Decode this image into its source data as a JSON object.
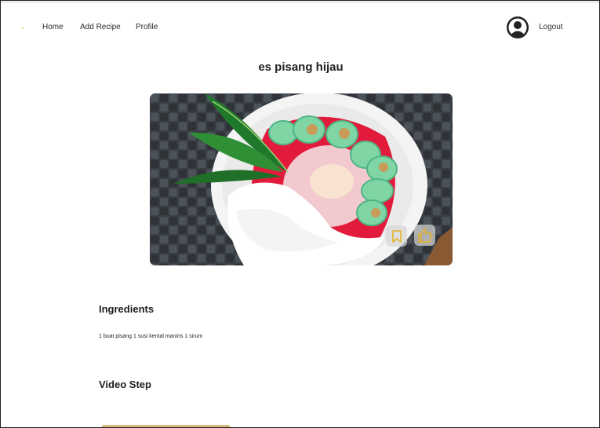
{
  "nav": {
    "home_label": "Home",
    "add_recipe_label": "Add Recipe",
    "profile_label": "Profile",
    "logout_label": "Logout"
  },
  "recipe": {
    "title": "es pisang hijau",
    "ingredients_heading": "Ingredients",
    "ingredients_text": "1 buat pisang 1 susi kental manins 1 sirum",
    "video_heading": "Video Step"
  },
  "icons": {
    "avatar": "user-avatar-icon",
    "bookmark": "bookmark-icon",
    "like": "thumbs-up-icon"
  },
  "colors": {
    "accent": "#e6b325",
    "video_bar": "#d8b979"
  }
}
